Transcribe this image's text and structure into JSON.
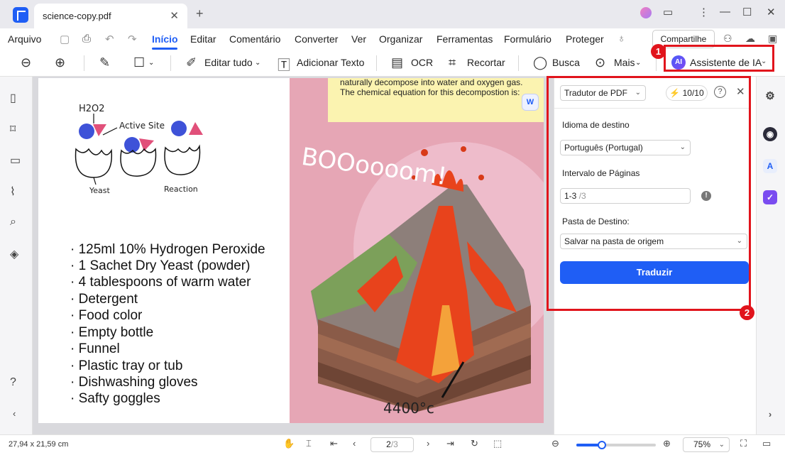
{
  "tab": {
    "title": "science-copy.pdf",
    "close": "✕",
    "new": "+"
  },
  "window": {
    "menu": "⋮",
    "minimize": "—",
    "maximize": "☐",
    "close": "✕"
  },
  "menu": {
    "items": [
      "Arquivo",
      "Início",
      "Editar",
      "Comentário",
      "Converter",
      "Ver",
      "Organizar",
      "Ferramentas",
      "Formulário",
      "Proteger"
    ],
    "active": "Início",
    "share_label": "Compartilhe"
  },
  "toolbar": {
    "edit_all": "Editar tudo",
    "add_text": "Adicionar Texto",
    "ocr": "OCR",
    "crop": "Recortar",
    "search": "Busca",
    "more": "Mais",
    "ai_badge": "AI",
    "ai_assistant": "Assistente de IA"
  },
  "markers": {
    "one": "1",
    "two": "2"
  },
  "document": {
    "sticky_lines": [
      "naturally decompose into water and oxygen gas.",
      "The chemical equation for this decompostion is:"
    ],
    "translate_chip": "W",
    "handwritten": {
      "h2o2": "H2O2",
      "active_site": "Active Site",
      "yeast": "Yeast",
      "reaction": "Reaction",
      "boom": "BOOoooom!",
      "temperature": "4400°c"
    },
    "bullets": [
      "· 125ml 10% Hydrogen Peroxide",
      "· 1 Sachet Dry Yeast (powder)",
      "· 4 tablespoons of warm water",
      "· Detergent",
      "· Food color",
      "· Empty bottle",
      "· Funnel",
      "· Plastic tray or tub",
      "· Dishwashing gloves",
      "· Safty goggles"
    ]
  },
  "translator": {
    "mode": "Tradutor de PDF",
    "credits": "10/10",
    "help": "?",
    "close": "✕",
    "target_language_label": "Idioma de destino",
    "target_language": "Português (Portugal)",
    "page_range_label": "Intervalo de Páginas",
    "page_range_value": "1-3",
    "page_range_total": "/3",
    "info": "!",
    "dest_folder_label": "Pasta de Destino:",
    "dest_folder": "Salvar na pasta de origem",
    "translate_button": "Traduzir"
  },
  "statusbar": {
    "page_size": "27,94 x 21,59 cm",
    "page_current": "2",
    "page_total": "/3",
    "zoom": "75%",
    "zoom_level": 0.32
  },
  "colors": {
    "accent": "#1f5ef5",
    "highlight": "#e1141c"
  }
}
